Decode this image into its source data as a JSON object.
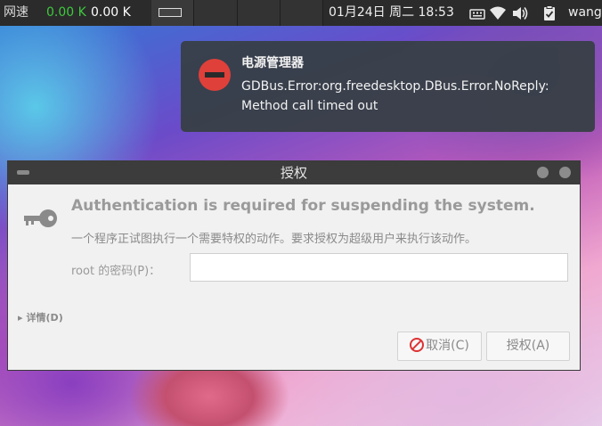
{
  "topbar": {
    "net_label": "网速",
    "net_down": "0.00 K",
    "net_up": "0.00 K",
    "clock": "01月24日 周二 18:53",
    "user": "wang",
    "tray_icons": [
      "keyboard-icon",
      "wifi-icon",
      "volume-icon",
      "clipboard-icon"
    ]
  },
  "notification": {
    "title": "电源管理器",
    "body_line1": "GDBus.Error:org.freedesktop.DBus.Error.NoReply:",
    "body_line2": "Method call timed out",
    "icon": "stop-icon",
    "icon_color": "#e0403a"
  },
  "dialog": {
    "title": "授权",
    "heading": "Authentication is required for suspending the system.",
    "subtext": "一个程序正试图执行一个需要特权的动作。要求授权为超级用户来执行该动作。",
    "password_label": "root 的密码(P)：",
    "password_value": "",
    "details_label": "详情(D)",
    "cancel_label": "取消(C)",
    "authorize_label": "授权(A)"
  }
}
